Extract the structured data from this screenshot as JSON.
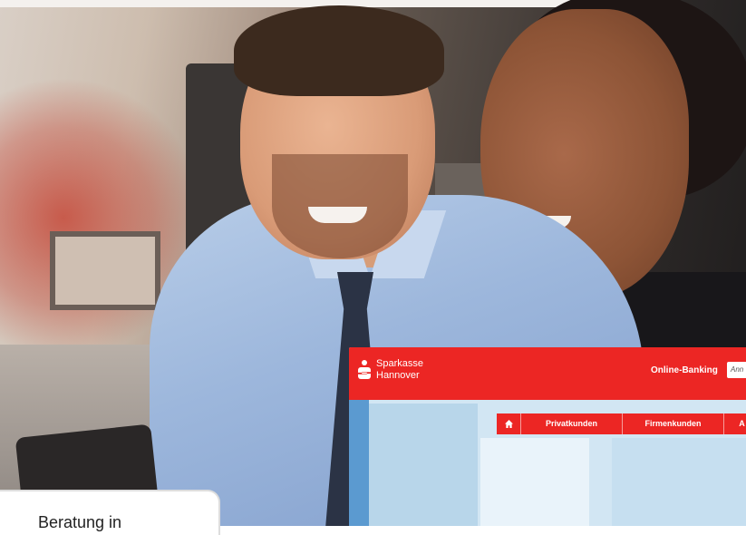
{
  "website": {
    "brand_line1": "Sparkasse",
    "brand_line2": "Hannover",
    "online_banking_label": "Online-Banking",
    "login_button_label": "Ann",
    "nav": {
      "home_icon": "home-icon",
      "items": [
        "Privatkunden",
        "Firmenkunden",
        "A"
      ]
    },
    "colors": {
      "brand_red": "#ec2624",
      "accent_blue": "#5b9ad0"
    }
  },
  "caption": {
    "text": "Beratung in"
  }
}
